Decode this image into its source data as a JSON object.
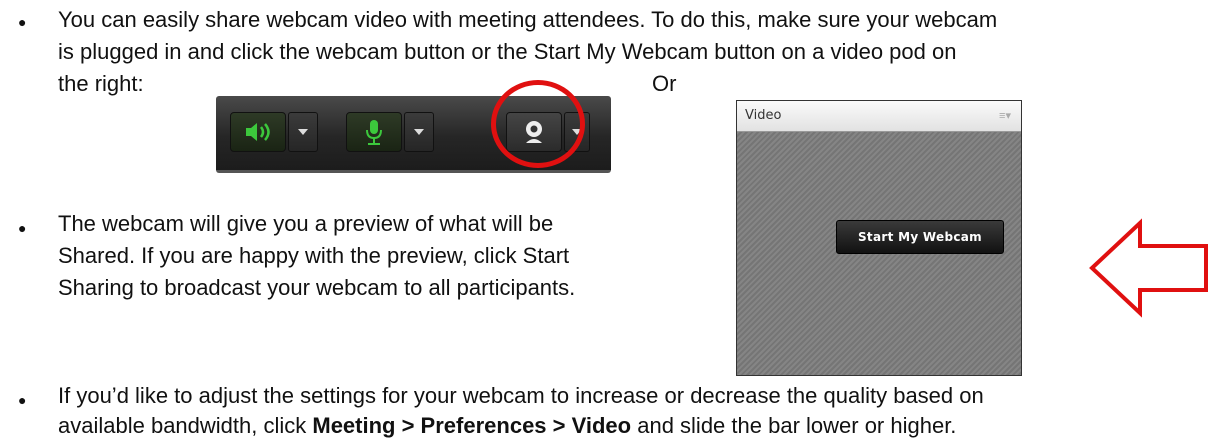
{
  "bullets": [
    {
      "line1": "You can easily share webcam video with meeting attendees. To do this, make sure your webcam",
      "line2": "is plugged in and click the webcam button or the Start My Webcam button on a video pod on",
      "line3": "the right:",
      "trailing": "Or"
    },
    {
      "line1": "The webcam will give you a preview of what will be",
      "line2": "Shared. If you are happy with the preview, click Start",
      "line3": "Sharing to broadcast your webcam to all participants."
    },
    {
      "line1": "If you’d like to adjust the settings for your webcam to increase or decrease the quality based on",
      "line2_prefix": "available bandwidth, click ",
      "line2_bold": "Meeting > Preferences > Video",
      "line2_suffix": " and slide the bar lower or higher."
    }
  ],
  "toolbar": {
    "icons": [
      "speaker-icon",
      "microphone-icon",
      "webcam-icon"
    ],
    "accent_green": "#3cc83c",
    "highlight_color": "#e01010"
  },
  "video_pod": {
    "title": "Video",
    "menu_glyph": "≡▾",
    "start_button": "Start My Webcam"
  },
  "arrow_color": "#e01010"
}
